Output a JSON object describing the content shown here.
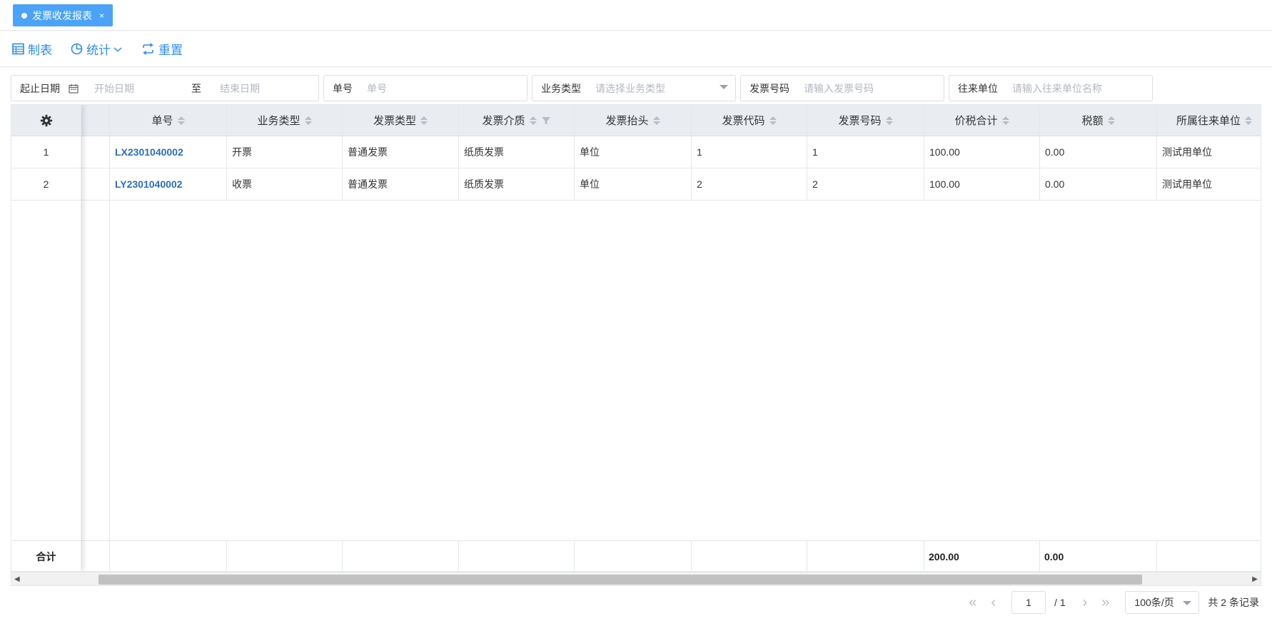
{
  "tab": {
    "label": "发票收发报表",
    "close": "×"
  },
  "toolbar": {
    "make_label": "制表",
    "stats_label": "统计",
    "reset_label": "重置"
  },
  "filters": {
    "date": {
      "label": "起止日期",
      "start_placeholder": "开始日期",
      "to": "至",
      "end_placeholder": "结束日期"
    },
    "order_no": {
      "label": "单号",
      "placeholder": "单号"
    },
    "biz_type": {
      "label": "业务类型",
      "placeholder": "请选择业务类型"
    },
    "invoice_no": {
      "label": "发票号码",
      "placeholder": "请输入发票号码"
    },
    "partner": {
      "label": "往来单位",
      "placeholder": "请输入往来单位名称"
    }
  },
  "table": {
    "columns": [
      "单号",
      "业务类型",
      "发票类型",
      "发票介质",
      "发票抬头",
      "发票代码",
      "发票号码",
      "价税合计",
      "税额",
      "所属往来单位"
    ],
    "rows": [
      {
        "idx": "1",
        "order_no": "LX2301040002",
        "biz_type": "开票",
        "invoice_type": "普通发票",
        "medium": "纸质发票",
        "title": "单位",
        "code": "1",
        "number": "1",
        "total": "100.00",
        "tax": "0.00",
        "partner": "测试用单位"
      },
      {
        "idx": "2",
        "order_no": "LY2301040002",
        "biz_type": "收票",
        "invoice_type": "普通发票",
        "medium": "纸质发票",
        "title": "单位",
        "code": "2",
        "number": "2",
        "total": "100.00",
        "tax": "0.00",
        "partner": "测试用单位"
      }
    ],
    "footer": {
      "label": "合计",
      "total": "200.00",
      "tax": "0.00"
    }
  },
  "pager": {
    "page": "1",
    "of": "/ 1",
    "page_size": "100条/页",
    "summary": "共 2 条记录"
  },
  "colors": {
    "accent": "#2d8cf0",
    "tab_bg": "#4aa3f7",
    "link": "#2a6ebd",
    "header_bg": "#e9ecf1"
  }
}
